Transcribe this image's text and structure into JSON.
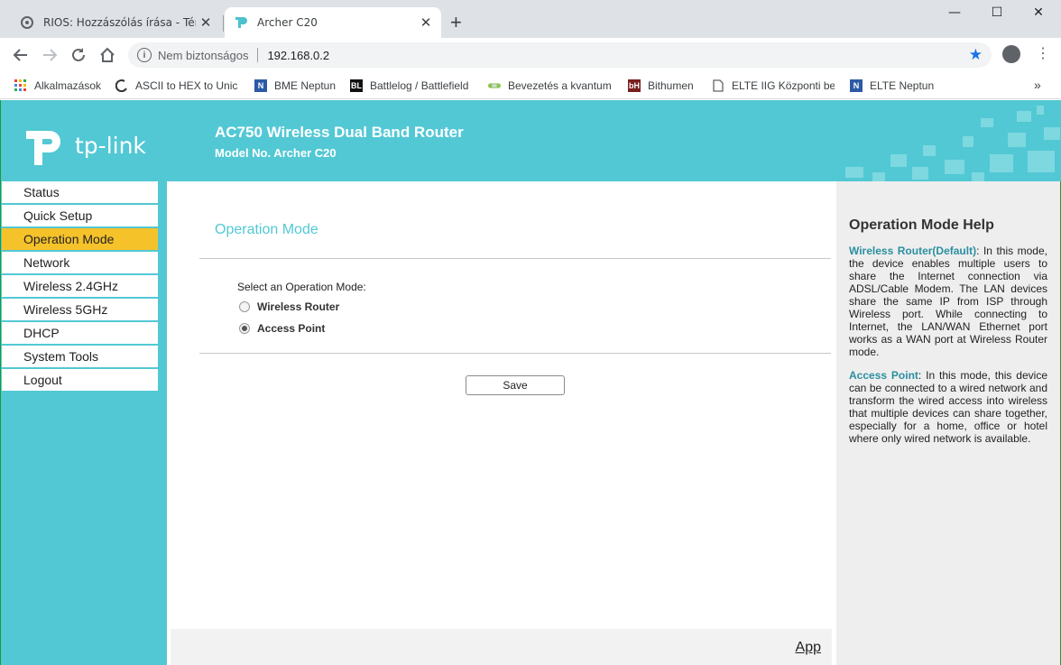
{
  "browser": {
    "tabs": [
      {
        "title": "RIOS: Hozzászólás írása - Téma: M",
        "active": false
      },
      {
        "title": "Archer C20",
        "active": true
      }
    ],
    "new_tab_label": "+",
    "window_controls": {
      "minimize": "—",
      "maximize": "☐",
      "close": "✕"
    },
    "address": {
      "security_label": "Nem biztonságos",
      "url": "192.168.0.2"
    },
    "bookmarks": [
      {
        "label": "Alkalmazások"
      },
      {
        "label": "ASCII to HEX to Unic"
      },
      {
        "label": "BME Neptun"
      },
      {
        "label": "Battlelog / Battlefield"
      },
      {
        "label": "Bevezetés a kvantum"
      },
      {
        "label": "Bithumen"
      },
      {
        "label": "ELTE IIG Központi bej"
      },
      {
        "label": "ELTE Neptun"
      }
    ],
    "bookmarks_more": "»",
    "colors": {
      "accent": "#1a73e8",
      "tabbar": "#dee1e6"
    }
  },
  "router": {
    "brand": "tp-link",
    "product_title": "AC750 Wireless Dual Band Router",
    "model": "Model No. Archer C20",
    "colors": {
      "primary": "#52c8d4",
      "active_menu": "#f6c22a",
      "help_bg": "#eeeeee"
    },
    "menu": [
      {
        "label": "Status"
      },
      {
        "label": "Quick Setup"
      },
      {
        "label": "Operation Mode",
        "active": true
      },
      {
        "label": "Network"
      },
      {
        "label": "Wireless 2.4GHz"
      },
      {
        "label": "Wireless 5GHz"
      },
      {
        "label": "DHCP"
      },
      {
        "label": "System Tools"
      },
      {
        "label": "Logout"
      }
    ],
    "main": {
      "section_title": "Operation Mode",
      "select_label": "Select an Operation Mode:",
      "options": [
        {
          "label": "Wireless Router",
          "checked": false
        },
        {
          "label": "Access Point",
          "checked": true
        }
      ],
      "save_label": "Save",
      "footer_link": "App"
    },
    "help": {
      "title": "Operation Mode Help",
      "paragraphs": [
        {
          "term": "Wireless Router(Default)",
          "text": ": In this mode, the device enables multiple users to share the Internet connection via ADSL/Cable Modem. The LAN devices share the same IP from ISP through Wireless port. While connecting to Internet, the LAN/WAN Ethernet port works as a WAN port at Wireless Router mode."
        },
        {
          "term": "Access Point",
          "text": ": In this mode, this device can be connected to a wired network and transform the wired access into wireless that multiple devices can share together, especially for a home, office or hotel where only wired network is available."
        }
      ]
    }
  }
}
